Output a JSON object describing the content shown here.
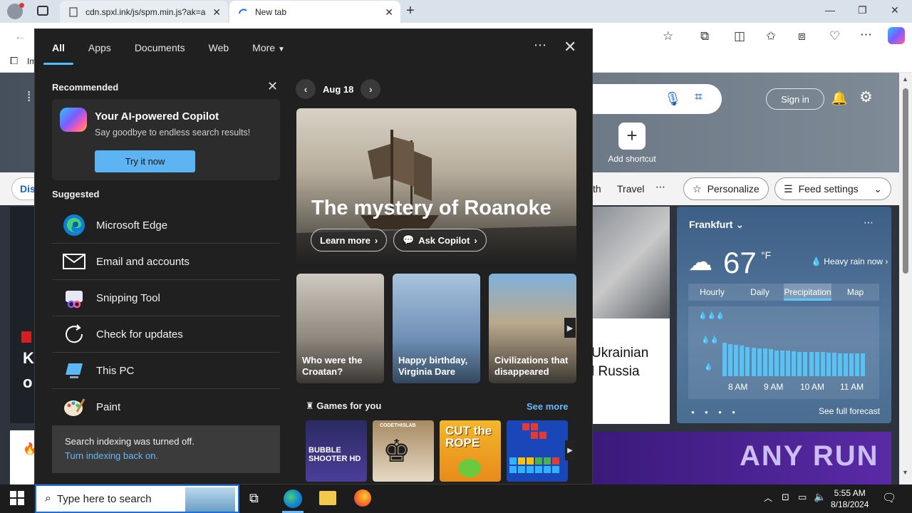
{
  "browser": {
    "tabs": [
      {
        "title": "cdn.spxl.ink/js/spm.min.js?ak=a"
      },
      {
        "title": "New tab"
      }
    ],
    "bookmark_partial": "Im"
  },
  "newtab": {
    "sign_in": "Sign in",
    "add_shortcut": "Add shortcut",
    "nav_partial_1": "th",
    "nav_travel": "Travel",
    "personalize": "Personalize",
    "feed_settings": "Feed settings",
    "left_partial_tab": "Dis",
    "left_headline_1": "K",
    "left_headline_2": "o",
    "news_headline_1": "Ukrainian",
    "news_headline_2": "l Russia",
    "promo_text": "ANY RUN",
    "weather": {
      "city": "Frankfurt",
      "temp": "67",
      "unit": "°F",
      "condition": "Heavy rain now",
      "tabs": [
        "Hourly",
        "Daily",
        "Precipitation",
        "Map"
      ],
      "active_tab": "Precipitation",
      "times": [
        "8 AM",
        "9 AM",
        "10 AM",
        "11 AM"
      ],
      "precip_levels": [
        0.72,
        0.7,
        0.68,
        0.66,
        0.64,
        0.62,
        0.6,
        0.6,
        0.58,
        0.56,
        0.55,
        0.55,
        0.54,
        0.53,
        0.53,
        0.52,
        0.52,
        0.52,
        0.51,
        0.51,
        0.5,
        0.5,
        0.5,
        0.5,
        0.5
      ],
      "see_full": "See full forecast"
    }
  },
  "panel": {
    "tabs": [
      "All",
      "Apps",
      "Documents",
      "Web",
      "More"
    ],
    "active_tab": "All",
    "recommended": {
      "title": "Recommended",
      "card_title": "Your AI-powered Copilot",
      "card_sub": "Say goodbye to endless search results!",
      "card_btn": "Try it now"
    },
    "suggested": {
      "title": "Suggested",
      "items": [
        {
          "label": "Microsoft Edge",
          "icon": "edge-icon"
        },
        {
          "label": "Email and accounts",
          "icon": "mail-icon"
        },
        {
          "label": "Snipping Tool",
          "icon": "snipping-tool-icon"
        },
        {
          "label": "Check for updates",
          "icon": "update-icon"
        },
        {
          "label": "This PC",
          "icon": "pc-icon"
        },
        {
          "label": "Paint",
          "icon": "paint-icon"
        }
      ]
    },
    "indexing": {
      "msg": "Search indexing was turned off.",
      "link": "Turn indexing back on."
    },
    "highlights": {
      "date": "Aug 18",
      "hero_title": "The mystery of Roanoke",
      "learn_more": "Learn more",
      "ask_copilot": "Ask Copilot",
      "thumbs": [
        {
          "caption_1": "Who were the",
          "caption_2": "Croatan?"
        },
        {
          "caption_1": "Happy birthday,",
          "caption_2": "Virginia Dare"
        },
        {
          "caption_1": "Civilizations that",
          "caption_2": "disappeared"
        }
      ]
    },
    "games": {
      "title": "Games for you",
      "see_more": "See more",
      "tiles": [
        "BUBBLE SHOOTER HD",
        "CODETHISLAB",
        "CUT the ROPE",
        ""
      ]
    }
  },
  "taskbar": {
    "search_placeholder": "Type here to search",
    "time": "5:55 AM",
    "date": "8/18/2024"
  }
}
